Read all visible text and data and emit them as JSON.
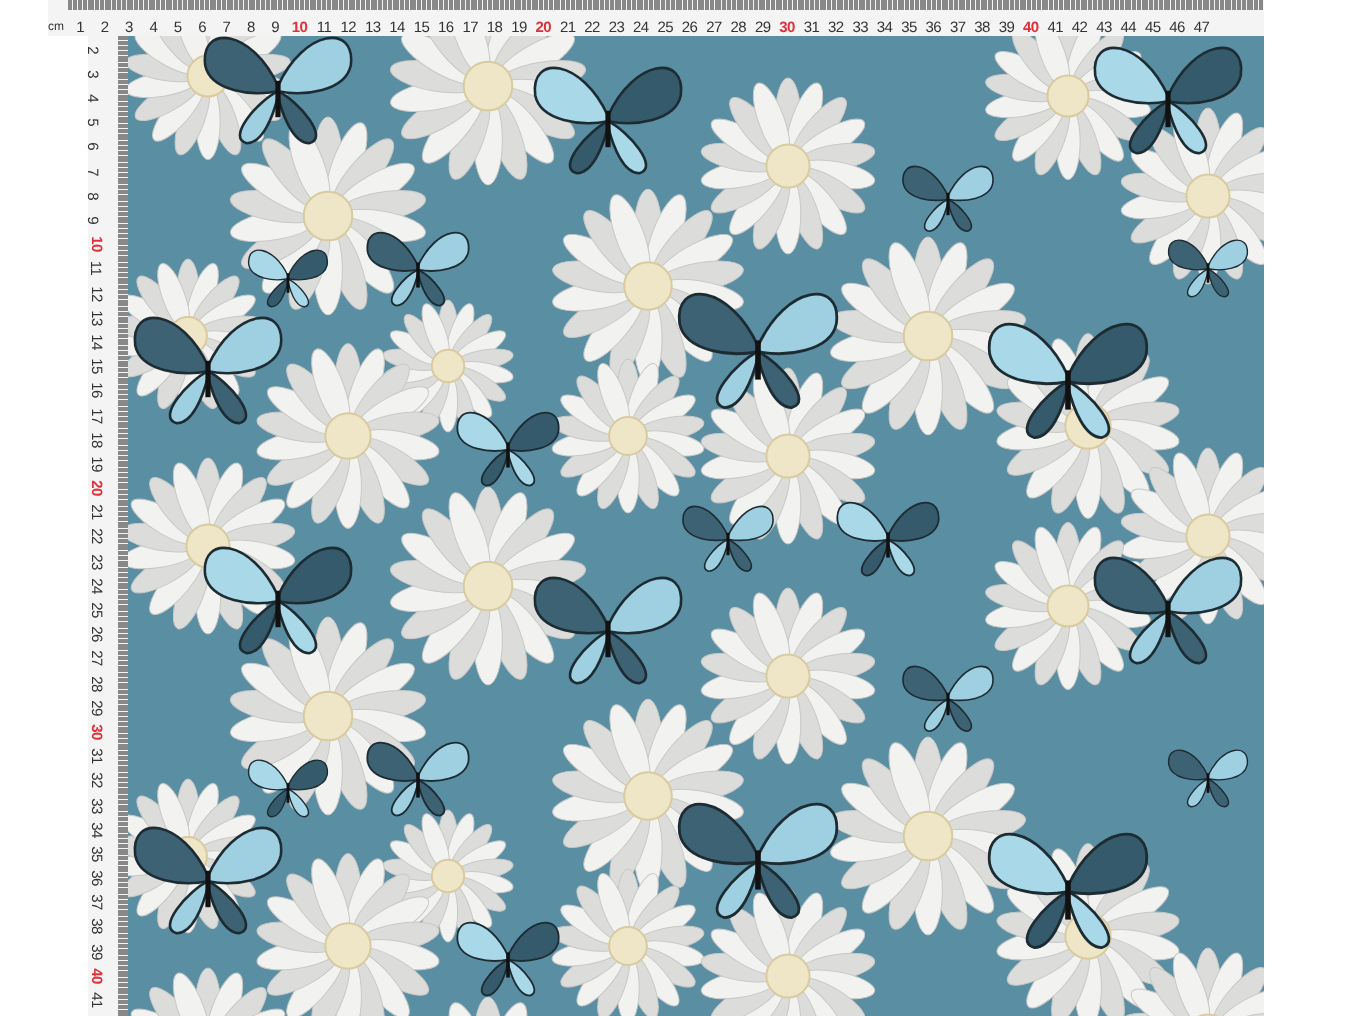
{
  "ruler": {
    "unit": "cm",
    "top": [
      {
        "label": "1",
        "major": false
      },
      {
        "label": "2",
        "major": false
      },
      {
        "label": "3",
        "major": false
      },
      {
        "label": "4",
        "major": false
      },
      {
        "label": "5",
        "major": false
      },
      {
        "label": "6",
        "major": false
      },
      {
        "label": "7",
        "major": false
      },
      {
        "label": "8",
        "major": false
      },
      {
        "label": "9",
        "major": false
      },
      {
        "label": "10",
        "major": true
      },
      {
        "label": "11",
        "major": false
      },
      {
        "label": "12",
        "major": false
      },
      {
        "label": "13",
        "major": false
      },
      {
        "label": "14",
        "major": false
      },
      {
        "label": "15",
        "major": false
      },
      {
        "label": "16",
        "major": false
      },
      {
        "label": "17",
        "major": false
      },
      {
        "label": "18",
        "major": false
      },
      {
        "label": "19",
        "major": false
      },
      {
        "label": "20",
        "major": true
      },
      {
        "label": "21",
        "major": false
      },
      {
        "label": "22",
        "major": false
      },
      {
        "label": "23",
        "major": false
      },
      {
        "label": "24",
        "major": false
      },
      {
        "label": "25",
        "major": false
      },
      {
        "label": "26",
        "major": false
      },
      {
        "label": "27",
        "major": false
      },
      {
        "label": "28",
        "major": false
      },
      {
        "label": "29",
        "major": false
      },
      {
        "label": "30",
        "major": true
      },
      {
        "label": "31",
        "major": false
      },
      {
        "label": "32",
        "major": false
      },
      {
        "label": "33",
        "major": false
      },
      {
        "label": "34",
        "major": false
      },
      {
        "label": "35",
        "major": false
      },
      {
        "label": "36",
        "major": false
      },
      {
        "label": "37",
        "major": false
      },
      {
        "label": "38",
        "major": false
      },
      {
        "label": "39",
        "major": false
      },
      {
        "label": "40",
        "major": true
      },
      {
        "label": "41",
        "major": false
      },
      {
        "label": "42",
        "major": false
      },
      {
        "label": "43",
        "major": false
      },
      {
        "label": "44",
        "major": false
      },
      {
        "label": "45",
        "major": false
      },
      {
        "label": "46",
        "major": false
      },
      {
        "label": "47",
        "major": false
      }
    ],
    "left": [
      {
        "label": "2",
        "major": false
      },
      {
        "label": "3",
        "major": false
      },
      {
        "label": "4",
        "major": false
      },
      {
        "label": "5",
        "major": false
      },
      {
        "label": "6",
        "major": false
      },
      {
        "label": "7",
        "major": false
      },
      {
        "label": "8",
        "major": false
      },
      {
        "label": "9",
        "major": false
      },
      {
        "label": "10",
        "major": true
      },
      {
        "label": "11",
        "major": false
      },
      {
        "label": "12",
        "major": false
      },
      {
        "label": "13",
        "major": false
      },
      {
        "label": "14",
        "major": false
      },
      {
        "label": "15",
        "major": false
      },
      {
        "label": "16",
        "major": false
      },
      {
        "label": "17",
        "major": false
      },
      {
        "label": "18",
        "major": false
      },
      {
        "label": "19",
        "major": false
      },
      {
        "label": "20",
        "major": true
      },
      {
        "label": "21",
        "major": false
      },
      {
        "label": "22",
        "major": false
      },
      {
        "label": "23",
        "major": false
      },
      {
        "label": "24",
        "major": false
      },
      {
        "label": "25",
        "major": false
      },
      {
        "label": "26",
        "major": false
      },
      {
        "label": "27",
        "major": false
      },
      {
        "label": "28",
        "major": false
      },
      {
        "label": "29",
        "major": false
      },
      {
        "label": "30",
        "major": true
      },
      {
        "label": "31",
        "major": false
      },
      {
        "label": "32",
        "major": false
      },
      {
        "label": "33",
        "major": false
      },
      {
        "label": "34",
        "major": false
      },
      {
        "label": "35",
        "major": false
      },
      {
        "label": "36",
        "major": false
      },
      {
        "label": "37",
        "major": false
      },
      {
        "label": "38",
        "major": false
      },
      {
        "label": "39",
        "major": false
      },
      {
        "label": "40",
        "major": true
      },
      {
        "label": "41",
        "major": false
      }
    ]
  }
}
